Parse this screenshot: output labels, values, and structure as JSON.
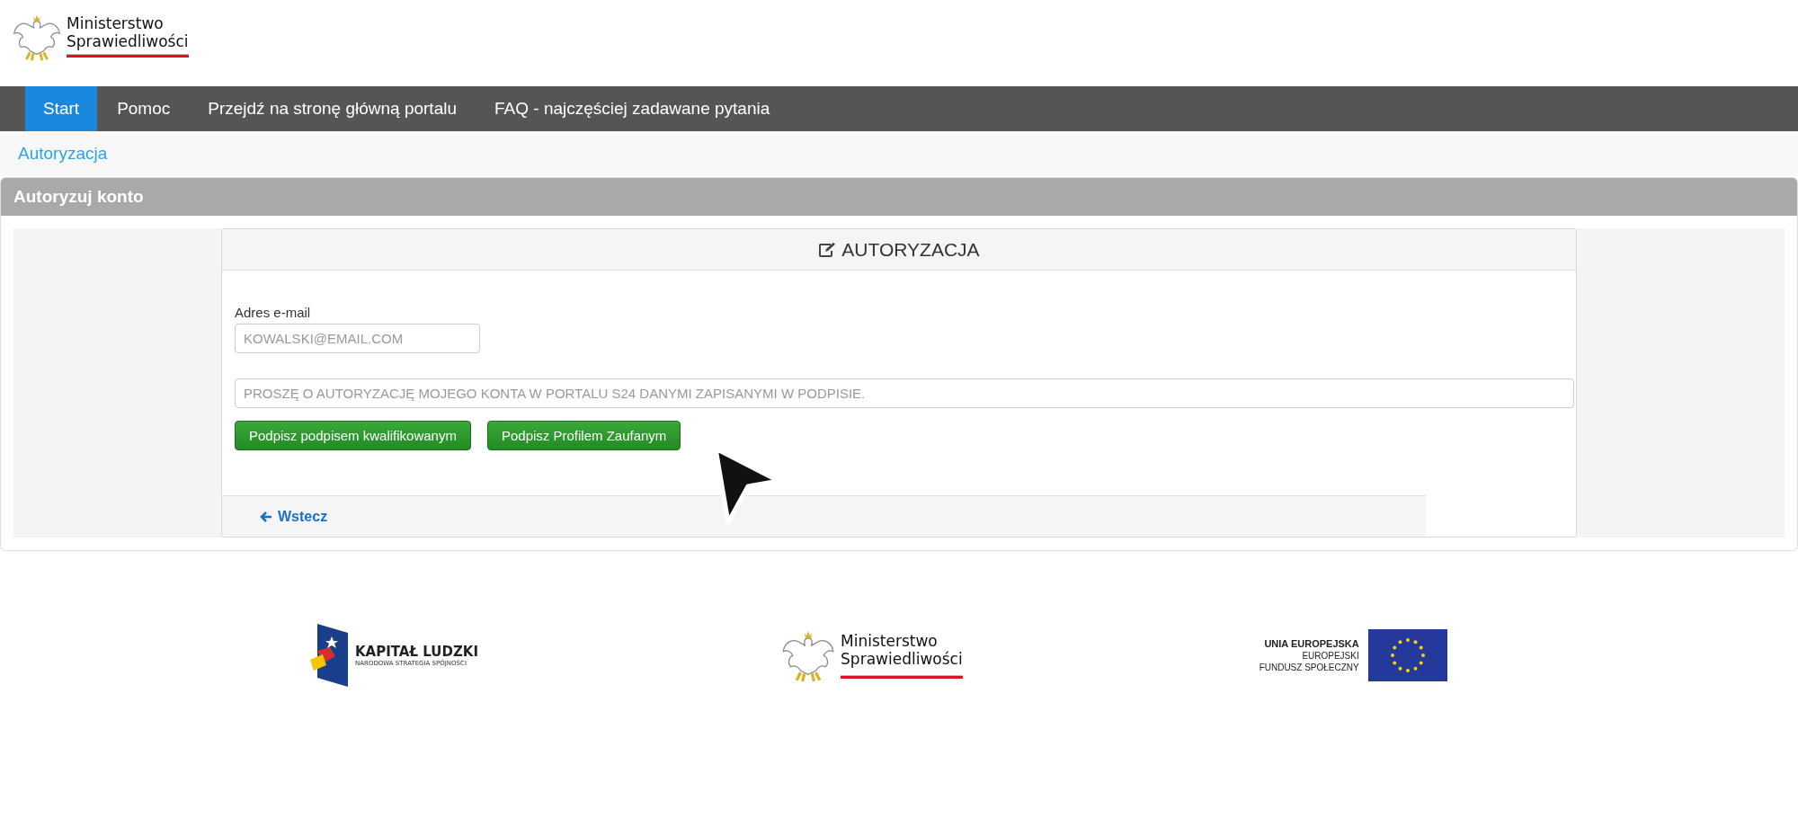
{
  "header": {
    "logo_line_1": "Ministerstwo",
    "logo_line_2": "Sprawiedliwości"
  },
  "nav": {
    "items": [
      {
        "label": "Start",
        "selected": true
      },
      {
        "label": "Pomoc",
        "selected": false
      },
      {
        "label": "Przejdź na stronę główną portalu",
        "selected": false
      },
      {
        "label": "FAQ - najczęściej zadawane pytania",
        "selected": false
      }
    ]
  },
  "breadcrumb": "Autoryzacja",
  "panel": {
    "title": "Autoryzuj konto",
    "card": {
      "title": "AUTORYZACJA",
      "email_label": "Adres e-mail",
      "email_placeholder": "KOWALSKI@EMAIL.COM",
      "statement_placeholder": "PROSZĘ O AUTORYZACJĘ MOJEGO KONTA W PORTALU S24 DANYMI ZAPISANYMI W PODPISIE.",
      "buttons": [
        "Podpisz podpisem kwalifikowanym",
        "Podpisz Profilem Zaufanym"
      ],
      "back_link": "Wstecz"
    }
  },
  "footer": {
    "kapital": {
      "title": "KAPITAŁ LUDZKI",
      "subtitle": "NARODOWA STRATEGIA SPÓJNOŚCI"
    },
    "ministry": {
      "line_1": "Ministerstwo",
      "line_2": "Sprawiedliwości"
    },
    "eu": {
      "line_1": "UNIA EUROPEJSKA",
      "line_2": "EUROPEJSKI",
      "line_3": "FUNDUSZ SPOŁECZNY"
    }
  }
}
